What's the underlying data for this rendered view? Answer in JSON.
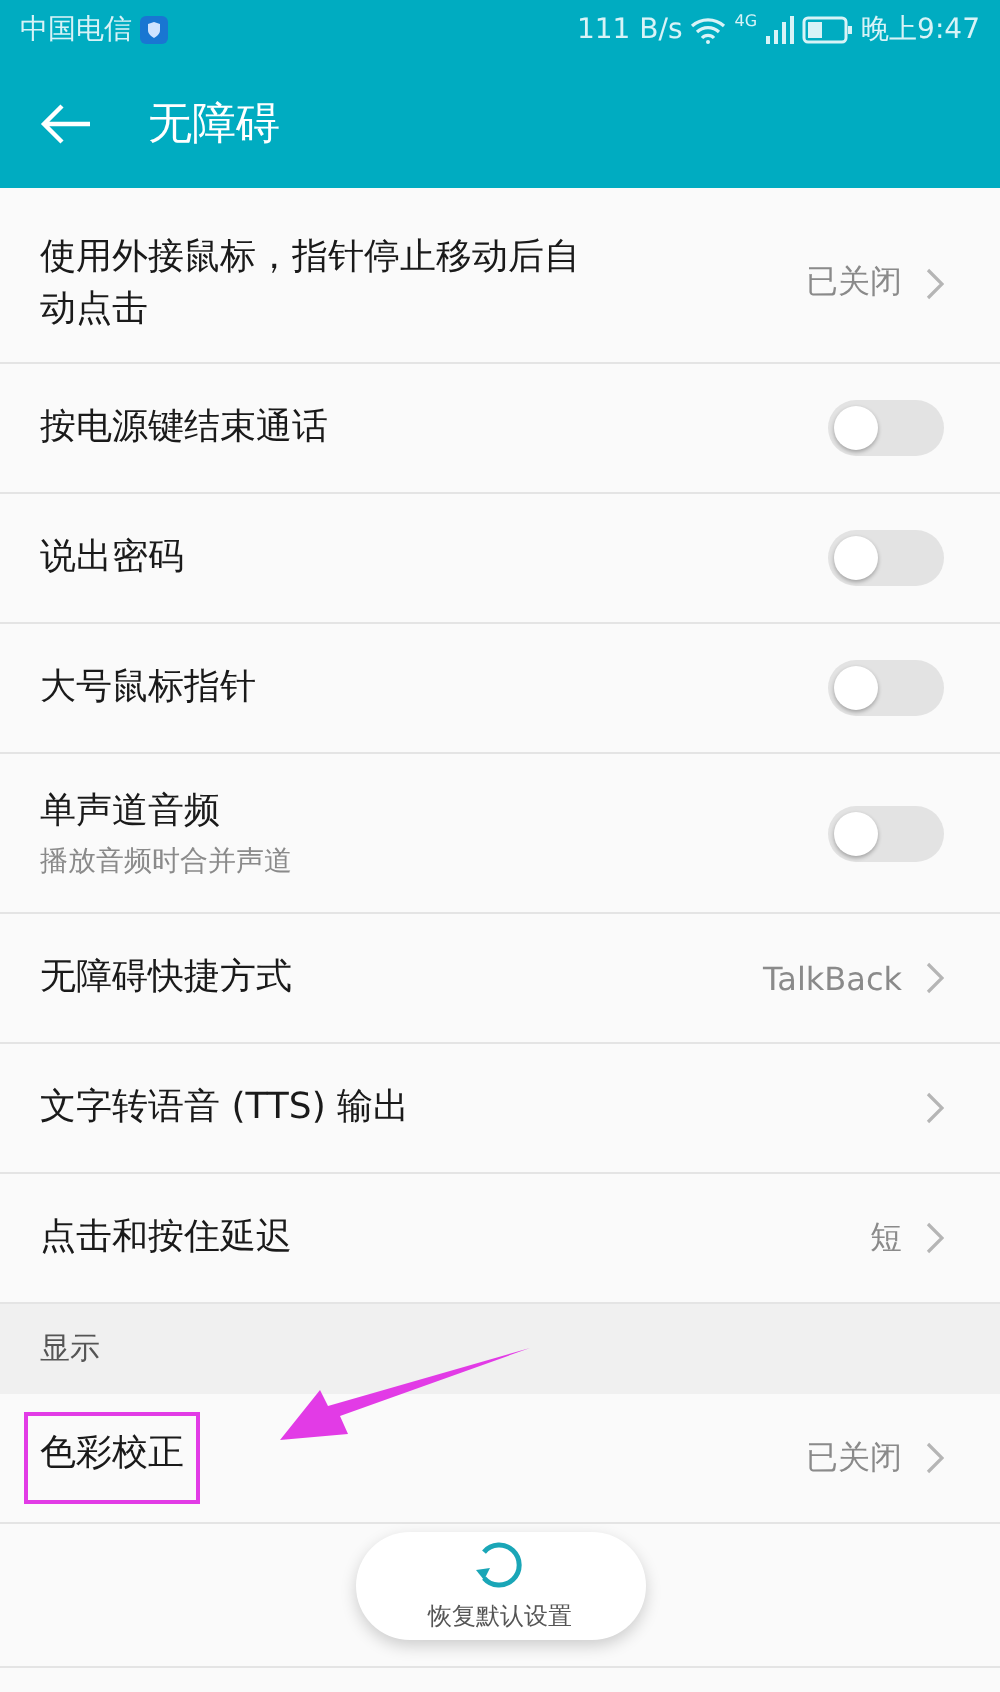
{
  "status_bar": {
    "carrier": "中国电信",
    "speed": "111 B/s",
    "network": "4G",
    "time": "晚上9:47"
  },
  "app_bar": {
    "title": "无障碍"
  },
  "sections": [
    {
      "rows": [
        {
          "kind": "value",
          "title": "使用外接鼠标，指针停止移动后自动点击",
          "value": "已关闭",
          "highlighted": false
        },
        {
          "kind": "switch",
          "title": "按电源键结束通话",
          "on": false,
          "highlighted": false
        },
        {
          "kind": "switch",
          "title": "说出密码",
          "on": false,
          "highlighted": false
        },
        {
          "kind": "switch",
          "title": "大号鼠标指针",
          "on": false,
          "highlighted": false
        },
        {
          "kind": "switch",
          "title": "单声道音频",
          "subtitle": "播放音频时合并声道",
          "on": false,
          "highlighted": false
        },
        {
          "kind": "value",
          "title": "无障碍快捷方式",
          "value": "TalkBack",
          "highlighted": false
        },
        {
          "kind": "link",
          "title": "文字转语音 (TTS) 输出",
          "highlighted": false
        },
        {
          "kind": "value",
          "title": "点击和按住延迟",
          "value": "短",
          "highlighted": false
        }
      ]
    },
    {
      "header": "显示",
      "rows": [
        {
          "kind": "value",
          "title": "色彩校正",
          "value": "已关闭",
          "highlighted": true
        }
      ]
    }
  ],
  "reset_button": {
    "label": "恢复默认设置"
  }
}
